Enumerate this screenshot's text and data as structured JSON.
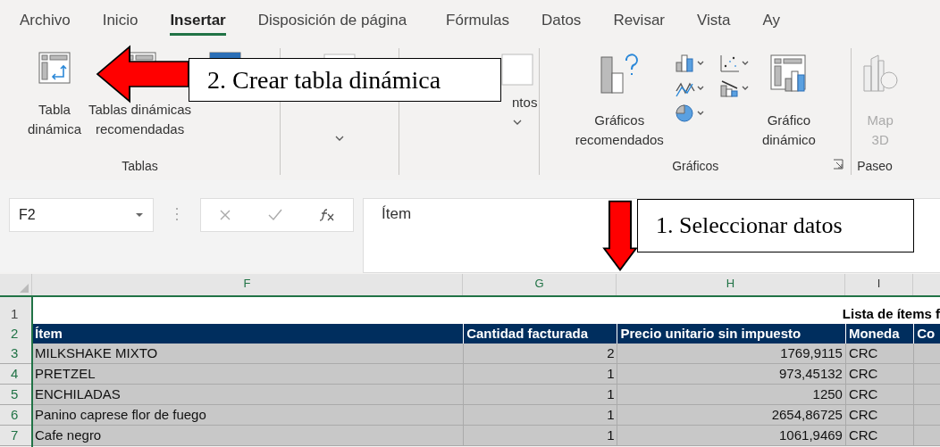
{
  "tabs": [
    {
      "label": "Archivo",
      "selected": false
    },
    {
      "label": "Inicio",
      "selected": false
    },
    {
      "label": "Insertar",
      "selected": true
    },
    {
      "label": "Disposición de página",
      "selected": false
    },
    {
      "label": "Fórmulas",
      "selected": false
    },
    {
      "label": "Datos",
      "selected": false
    },
    {
      "label": "Revisar",
      "selected": false
    },
    {
      "label": "Vista",
      "selected": false
    },
    {
      "label": "Ay",
      "selected": false
    }
  ],
  "ribbon": {
    "tablas": {
      "label": "Tablas",
      "pivot": [
        "Tabla",
        "dinámica"
      ],
      "recommended": [
        "Tablas dinámicas",
        "recomendadas"
      ]
    },
    "complementos": {
      "label_visible": "ntos"
    },
    "graficos": {
      "label": "Gráficos",
      "recommended": [
        "Gráficos",
        "recomendados"
      ],
      "pivot_chart": [
        "Gráfico",
        "dinámico"
      ]
    },
    "paseo": {
      "label": "Paseo",
      "map": [
        "Map",
        "3D"
      ]
    }
  },
  "formula_bar": {
    "name_box": "F2",
    "value": "Ítem"
  },
  "sheet": {
    "columns": [
      "F",
      "G",
      "H",
      "I"
    ],
    "title_row": {
      "number": "1",
      "text": "Lista de ítems f"
    },
    "header": {
      "number": "2",
      "cells": [
        "Ítem",
        "Cantidad facturada",
        "Precio unitario sin impuesto",
        "Moneda",
        "Co"
      ]
    },
    "rows": [
      {
        "number": "3",
        "cells": [
          "MILKSHAKE MIXTO",
          "2",
          "1769,9115",
          "CRC"
        ]
      },
      {
        "number": "4",
        "cells": [
          "PRETZEL",
          "1",
          "973,45132",
          "CRC"
        ]
      },
      {
        "number": "5",
        "cells": [
          "ENCHILADAS",
          "1",
          "1250",
          "CRC"
        ]
      },
      {
        "number": "6",
        "cells": [
          "Panino caprese flor de fuego",
          "1",
          "2654,86725",
          "CRC"
        ]
      },
      {
        "number": "7",
        "cells": [
          "Cafe negro",
          "1",
          "1061,9469",
          "CRC"
        ]
      }
    ]
  },
  "callouts": [
    {
      "text": "2. Crear tabla dinámica"
    },
    {
      "text": "1. Seleccionar datos"
    }
  ]
}
